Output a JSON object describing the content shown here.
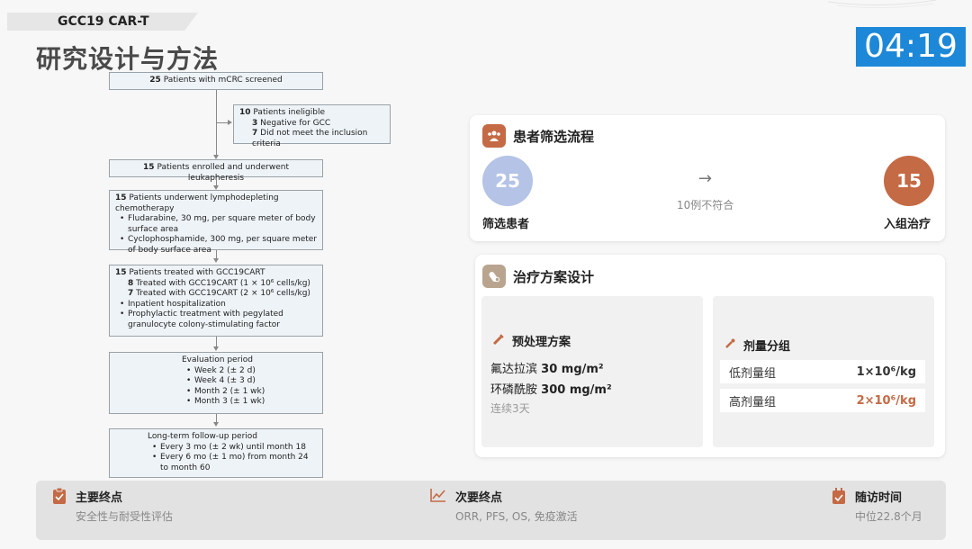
{
  "header": {
    "topic_tag": "GCC19 CAR-T",
    "title": "研究设计与方法",
    "timer": "04:19"
  },
  "flowchart": {
    "screened": {
      "num": "25",
      "text": "Patients with mCRC screened"
    },
    "ineligible": {
      "num": "10",
      "text": "Patients ineligible",
      "items": [
        {
          "num": "3",
          "text": "Negative for GCC"
        },
        {
          "num": "7",
          "text": "Did not meet the inclusion criteria"
        }
      ]
    },
    "enrolled": {
      "num": "15",
      "text": "Patients enrolled and underwent leukapheresis"
    },
    "chemo": {
      "num": "15",
      "text": "Patients underwent lymphodepleting chemotherapy",
      "bullets": [
        "Fludarabine, 30 mg, per square meter of body surface area",
        "Cyclophosphamide, 300 mg, per square meter of body surface area"
      ]
    },
    "treated": {
      "num": "15",
      "text": "Patients treated with GCC19CART",
      "items": [
        {
          "num": "8",
          "text": "Treated with GCC19CART (1 × 10⁶ cells/kg)"
        },
        {
          "num": "7",
          "text": "Treated with GCC19CART (2 × 10⁶ cells/kg)"
        }
      ],
      "bullets": [
        "Inpatient hospitalization",
        "Prophylactic treatment with pegylated granulocyte colony-stimulating factor"
      ]
    },
    "evaluation": {
      "title": "Evaluation period",
      "bullets": [
        "Week 2 (± 2 d)",
        "Week 4 (± 3 d)",
        "Month 2 (± 1 wk)",
        "Month 3 (± 1 wk)"
      ]
    },
    "followup": {
      "title": "Long-term follow-up period",
      "bullets": [
        "Every 3 mo (± 2 wk) until month 18",
        "Every 6 mo (± 1 mo) from month 24 to month 60"
      ]
    }
  },
  "screening_card": {
    "title": "患者筛选流程",
    "screened_count": "25",
    "screened_label": "筛选患者",
    "excluded_text": "10例不符合",
    "enrolled_count": "15",
    "enrolled_label": "入组治疗",
    "colors": {
      "screened": "#b4c3e6",
      "enrolled": "#c46a45"
    }
  },
  "regimen_card": {
    "title": "治疗方案设计",
    "pretreatment": {
      "title": "预处理方案",
      "drug1_name": "氟达拉滨",
      "drug1_dose": "30 mg/m²",
      "drug2_name": "环磷酰胺",
      "drug2_dose": "300 mg/m²",
      "duration": "连续3天"
    },
    "dose_groups": {
      "title": "剂量分组",
      "rows": [
        {
          "label": "低剂量组",
          "value": "1×10⁶/kg"
        },
        {
          "label": "高剂量组",
          "value": "2×10⁶/kg"
        }
      ]
    }
  },
  "bottom_bar": {
    "primary": {
      "title": "主要终点",
      "value": "安全性与耐受性评估",
      "icon": "clipboard-icon"
    },
    "secondary": {
      "title": "次要终点",
      "value": "ORR, PFS, OS, 免疫激活",
      "icon": "line-chart-icon"
    },
    "followup": {
      "title": "随访时间",
      "value": "中位22.8个月",
      "icon": "calendar-check-icon"
    }
  },
  "colors": {
    "accent": "#c46a45",
    "timer": "#1e88d8",
    "icon_tan": "#b9a58f"
  }
}
